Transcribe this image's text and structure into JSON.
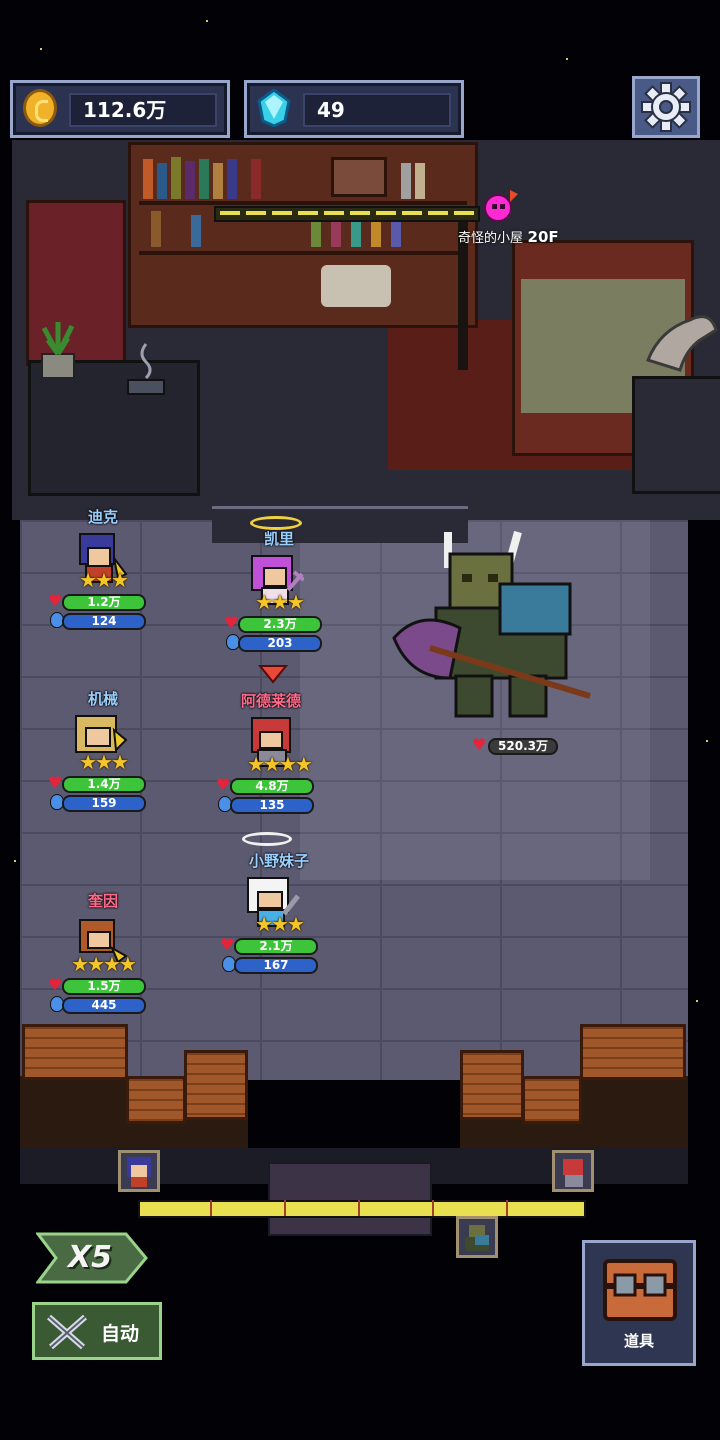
{
  "resources": {
    "gold": "112.6万",
    "gems": "49"
  },
  "stage": {
    "name": "奇怪的小屋",
    "floor": "20F"
  },
  "heroes": [
    {
      "name": "迪克",
      "stars": "★★★",
      "hp": "1.2万",
      "mp": "124"
    },
    {
      "name": "凯里",
      "stars": "★★★",
      "hp": "2.3万",
      "mp": "203"
    },
    {
      "name": "机械",
      "stars": "★★★",
      "hp": "1.4万",
      "mp": "159"
    },
    {
      "name": "阿德莱德",
      "stars": "★★★★",
      "hp": "4.8万",
      "mp": "135"
    },
    {
      "name": "小野妹子",
      "stars": "★★★",
      "hp": "2.1万",
      "mp": "167"
    },
    {
      "name": "奎因",
      "stars": "★★★★",
      "hp": "1.5万",
      "mp": "445"
    }
  ],
  "boss": {
    "hp": "520.3万"
  },
  "progress": {
    "percent": 100
  },
  "controls": {
    "speed": "X5",
    "auto": "自动",
    "items": "道具"
  },
  "icons": {
    "gold": "gold-coin-icon",
    "gem": "blue-gem-icon",
    "settings": "gear-icon",
    "hp": "heart-icon",
    "mp": "potion-icon",
    "auto": "crossed-swords-icon",
    "items": "treasure-chest-icon",
    "boss": "skull-icon"
  },
  "colors": {
    "hp_bar": "#3ec43a",
    "mp_bar": "#2d62c8",
    "star": "#f5c628",
    "heart": "#e4243a",
    "boss_marker": "#ff2ad4"
  }
}
